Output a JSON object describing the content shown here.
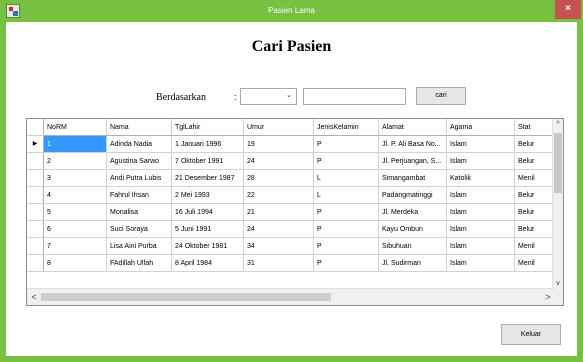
{
  "window": {
    "title": "Pasien Lama",
    "close_label": "×"
  },
  "heading": "Cari Pasien",
  "search": {
    "by_label": "Berdasarkan",
    "colon": ":",
    "combo_arrow": "⌄",
    "input_value": "",
    "button_label": "cari"
  },
  "grid": {
    "columns": [
      "NoRM",
      "Nama",
      "TglLahir",
      "Umur",
      "JenisKelamin",
      "Alamat",
      "Agama",
      "Stat"
    ],
    "rows": [
      [
        "1",
        "Adinda Nadia",
        "1 Januari 1996",
        "19",
        "P",
        "Jl. P. Ali Basa No...",
        "Islam",
        "Belur"
      ],
      [
        "2",
        "Agustina Sarwo",
        "7 Oktober 1991",
        "24",
        "P",
        "Jl. Perjuangan, S...",
        "Islam",
        "Belur"
      ],
      [
        "3",
        "Andi Putra Lubis",
        "21 Desember 1987",
        "28",
        "L",
        "Simangambat",
        "Katolik",
        "Menil"
      ],
      [
        "4",
        "Fahrul Ihsan",
        "2 Mei 1993",
        "22",
        "L",
        "Padangmatinggi",
        "Islam",
        "Belur"
      ],
      [
        "5",
        "Monalisa",
        "16 Juli 1994",
        "21",
        "P",
        "Jl. Merdeka",
        "Islam",
        "Belur"
      ],
      [
        "6",
        "Suci Soraya",
        "5 Juni 1991",
        "24",
        "P",
        "Kayu Ombun",
        "Islam",
        "Belur"
      ],
      [
        "7",
        "Lisa Aini Purba",
        "24 Oktober 1981",
        "34",
        "P",
        "Sibuhuan",
        "Islam",
        "Menil"
      ],
      [
        "8",
        "FAdillah Ulfah",
        "8 April 1984",
        "31",
        "P",
        "Jl. Sudirman",
        "Islam",
        "Menil"
      ]
    ],
    "current_row_marker": "▶",
    "scroll_up": "^",
    "scroll_down": "v",
    "scroll_left": "<",
    "scroll_right": ">"
  },
  "footer": {
    "close_button": "Keluar"
  },
  "colors": {
    "frame": "#78c040",
    "close": "#c75050",
    "selection": "#3399ff"
  }
}
